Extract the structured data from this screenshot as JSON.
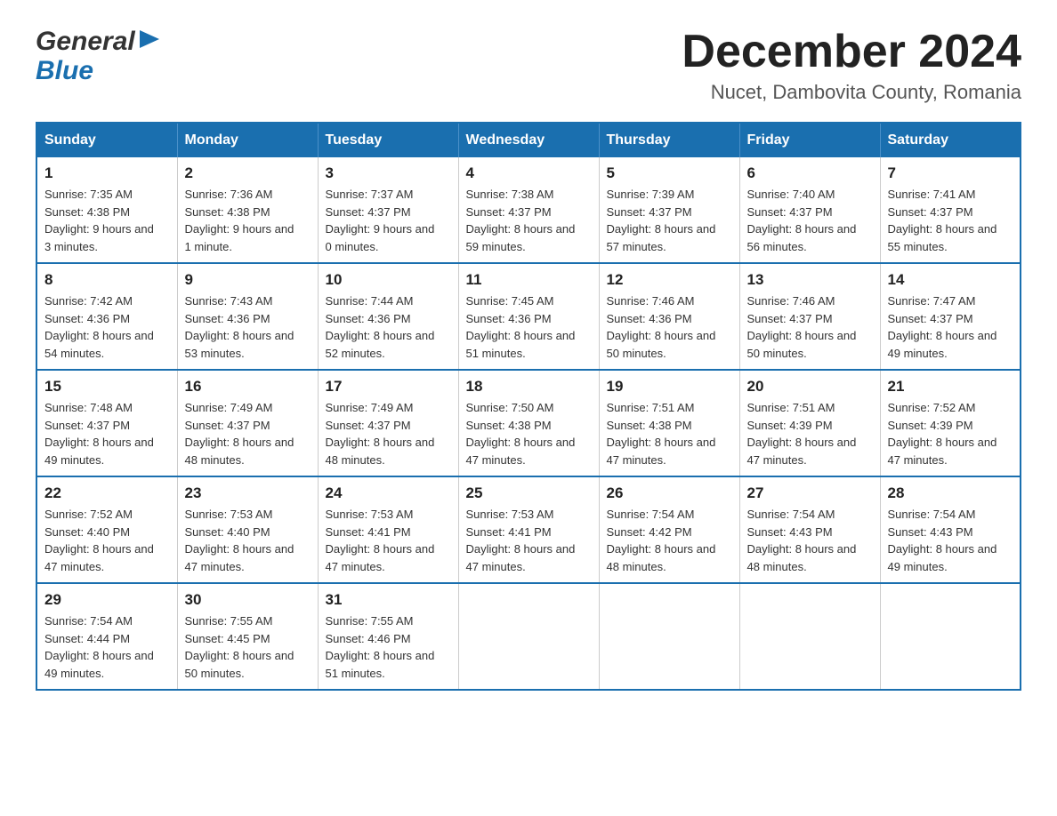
{
  "header": {
    "logo": {
      "general": "General",
      "blue": "Blue"
    },
    "title": "December 2024",
    "location": "Nucet, Dambovita County, Romania"
  },
  "calendar": {
    "headers": [
      "Sunday",
      "Monday",
      "Tuesday",
      "Wednesday",
      "Thursday",
      "Friday",
      "Saturday"
    ],
    "weeks": [
      [
        {
          "day": "1",
          "sunrise": "7:35 AM",
          "sunset": "4:38 PM",
          "daylight": "9 hours and 3 minutes."
        },
        {
          "day": "2",
          "sunrise": "7:36 AM",
          "sunset": "4:38 PM",
          "daylight": "9 hours and 1 minute."
        },
        {
          "day": "3",
          "sunrise": "7:37 AM",
          "sunset": "4:37 PM",
          "daylight": "9 hours and 0 minutes."
        },
        {
          "day": "4",
          "sunrise": "7:38 AM",
          "sunset": "4:37 PM",
          "daylight": "8 hours and 59 minutes."
        },
        {
          "day": "5",
          "sunrise": "7:39 AM",
          "sunset": "4:37 PM",
          "daylight": "8 hours and 57 minutes."
        },
        {
          "day": "6",
          "sunrise": "7:40 AM",
          "sunset": "4:37 PM",
          "daylight": "8 hours and 56 minutes."
        },
        {
          "day": "7",
          "sunrise": "7:41 AM",
          "sunset": "4:37 PM",
          "daylight": "8 hours and 55 minutes."
        }
      ],
      [
        {
          "day": "8",
          "sunrise": "7:42 AM",
          "sunset": "4:36 PM",
          "daylight": "8 hours and 54 minutes."
        },
        {
          "day": "9",
          "sunrise": "7:43 AM",
          "sunset": "4:36 PM",
          "daylight": "8 hours and 53 minutes."
        },
        {
          "day": "10",
          "sunrise": "7:44 AM",
          "sunset": "4:36 PM",
          "daylight": "8 hours and 52 minutes."
        },
        {
          "day": "11",
          "sunrise": "7:45 AM",
          "sunset": "4:36 PM",
          "daylight": "8 hours and 51 minutes."
        },
        {
          "day": "12",
          "sunrise": "7:46 AM",
          "sunset": "4:36 PM",
          "daylight": "8 hours and 50 minutes."
        },
        {
          "day": "13",
          "sunrise": "7:46 AM",
          "sunset": "4:37 PM",
          "daylight": "8 hours and 50 minutes."
        },
        {
          "day": "14",
          "sunrise": "7:47 AM",
          "sunset": "4:37 PM",
          "daylight": "8 hours and 49 minutes."
        }
      ],
      [
        {
          "day": "15",
          "sunrise": "7:48 AM",
          "sunset": "4:37 PM",
          "daylight": "8 hours and 49 minutes."
        },
        {
          "day": "16",
          "sunrise": "7:49 AM",
          "sunset": "4:37 PM",
          "daylight": "8 hours and 48 minutes."
        },
        {
          "day": "17",
          "sunrise": "7:49 AM",
          "sunset": "4:37 PM",
          "daylight": "8 hours and 48 minutes."
        },
        {
          "day": "18",
          "sunrise": "7:50 AM",
          "sunset": "4:38 PM",
          "daylight": "8 hours and 47 minutes."
        },
        {
          "day": "19",
          "sunrise": "7:51 AM",
          "sunset": "4:38 PM",
          "daylight": "8 hours and 47 minutes."
        },
        {
          "day": "20",
          "sunrise": "7:51 AM",
          "sunset": "4:39 PM",
          "daylight": "8 hours and 47 minutes."
        },
        {
          "day": "21",
          "sunrise": "7:52 AM",
          "sunset": "4:39 PM",
          "daylight": "8 hours and 47 minutes."
        }
      ],
      [
        {
          "day": "22",
          "sunrise": "7:52 AM",
          "sunset": "4:40 PM",
          "daylight": "8 hours and 47 minutes."
        },
        {
          "day": "23",
          "sunrise": "7:53 AM",
          "sunset": "4:40 PM",
          "daylight": "8 hours and 47 minutes."
        },
        {
          "day": "24",
          "sunrise": "7:53 AM",
          "sunset": "4:41 PM",
          "daylight": "8 hours and 47 minutes."
        },
        {
          "day": "25",
          "sunrise": "7:53 AM",
          "sunset": "4:41 PM",
          "daylight": "8 hours and 47 minutes."
        },
        {
          "day": "26",
          "sunrise": "7:54 AM",
          "sunset": "4:42 PM",
          "daylight": "8 hours and 48 minutes."
        },
        {
          "day": "27",
          "sunrise": "7:54 AM",
          "sunset": "4:43 PM",
          "daylight": "8 hours and 48 minutes."
        },
        {
          "day": "28",
          "sunrise": "7:54 AM",
          "sunset": "4:43 PM",
          "daylight": "8 hours and 49 minutes."
        }
      ],
      [
        {
          "day": "29",
          "sunrise": "7:54 AM",
          "sunset": "4:44 PM",
          "daylight": "8 hours and 49 minutes."
        },
        {
          "day": "30",
          "sunrise": "7:55 AM",
          "sunset": "4:45 PM",
          "daylight": "8 hours and 50 minutes."
        },
        {
          "day": "31",
          "sunrise": "7:55 AM",
          "sunset": "4:46 PM",
          "daylight": "8 hours and 51 minutes."
        },
        null,
        null,
        null,
        null
      ]
    ]
  }
}
